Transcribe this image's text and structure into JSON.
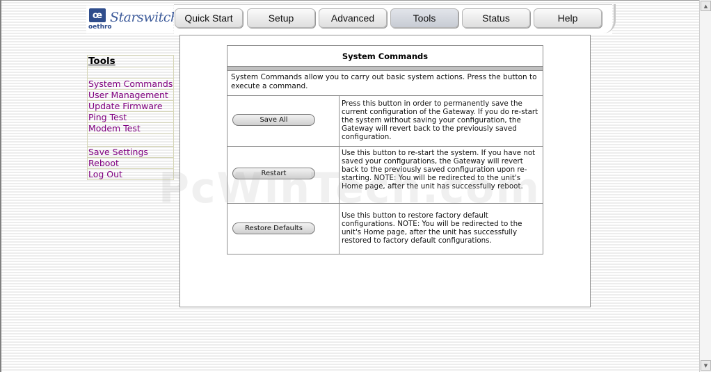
{
  "header": {
    "logo_badge": "œ",
    "logo_brand": "oethro",
    "logo_script": "Starswitch"
  },
  "tabs": [
    {
      "label": "Quick Start",
      "active": false
    },
    {
      "label": "Setup",
      "active": false
    },
    {
      "label": "Advanced",
      "active": false
    },
    {
      "label": "Tools",
      "active": true
    },
    {
      "label": "Status",
      "active": false
    },
    {
      "label": "Help",
      "active": false
    }
  ],
  "nav": {
    "title": "Tools",
    "items": [
      "System Commands",
      "User Management",
      "Update Firmware",
      "Ping Test",
      "Modem Test"
    ],
    "items2": [
      "Save Settings",
      "Reboot",
      "Log Out"
    ]
  },
  "main": {
    "title": "System Commands",
    "intro": "System Commands allow you to carry out basic system actions. Press the button to execute a command.",
    "commands": [
      {
        "button": "Save All",
        "description": "Press this button in order to permanently save the current configuration of the Gateway. If you do re-start the system without saving your configuration, the Gateway will revert back to the previously saved configuration."
      },
      {
        "button": "Restart",
        "description": "Use this button to re-start the system. If you have not saved your configurations, the Gateway will revert back to the previously saved configuration upon re-starting. NOTE: You will be redirected to the unit's Home page, after the unit has successfully reboot."
      },
      {
        "button": "Restore Defaults",
        "description": "Use this button to restore factory default configurations. NOTE: You will be redirected to the unit's Home page, after the unit has successfully restored to factory default configurations."
      }
    ]
  },
  "watermark": "PcWinTech.com",
  "colors": {
    "link": "#800080",
    "logo_blue": "#2f4d8c",
    "panel_border": "#8c8c8c"
  }
}
